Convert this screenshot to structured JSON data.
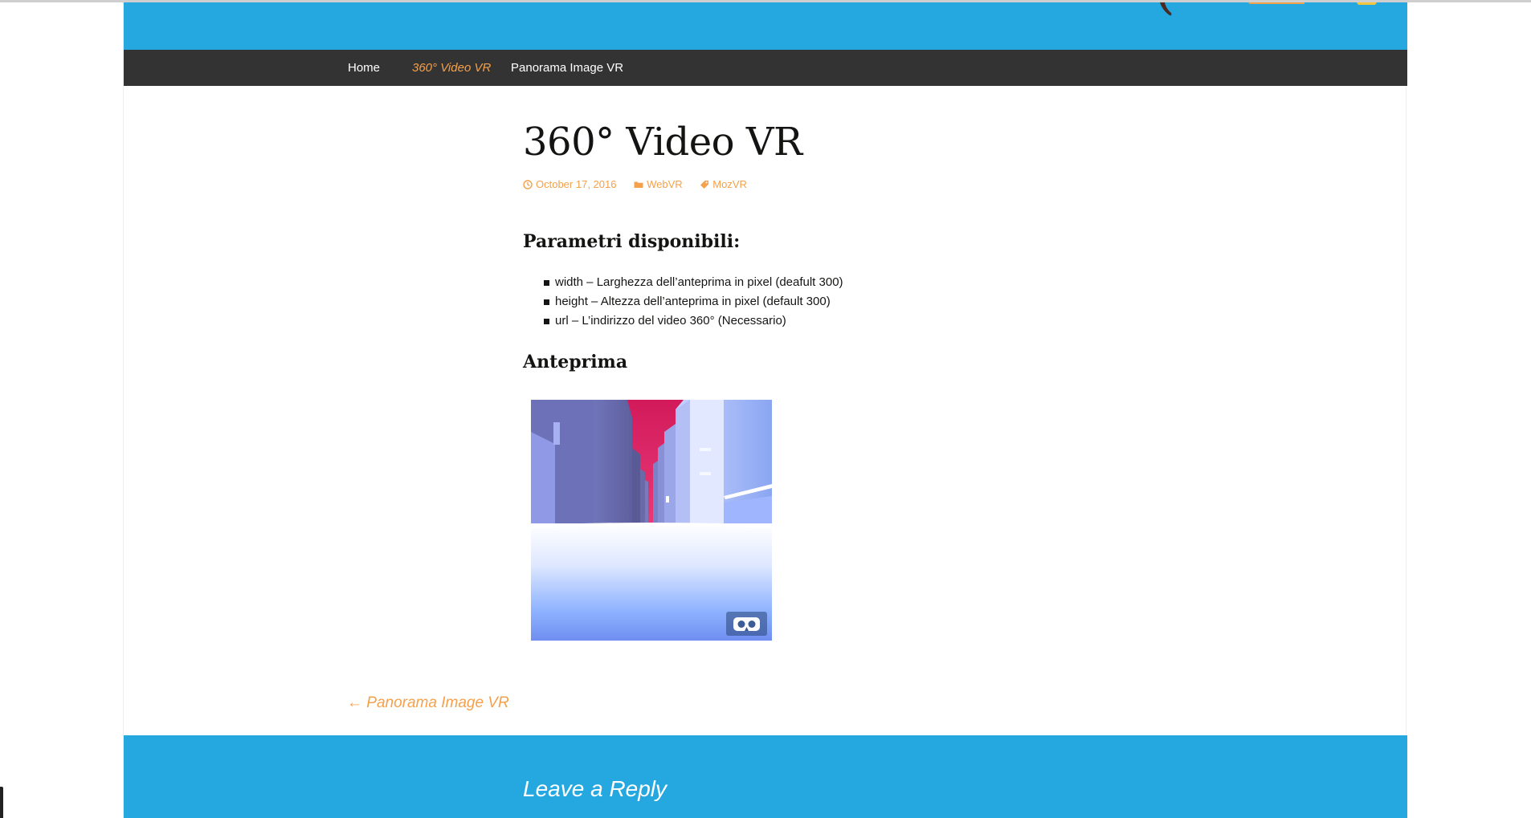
{
  "nav": {
    "items": [
      {
        "label": "Home"
      },
      {
        "label": "360° Video VR"
      },
      {
        "label": "Panorama Image VR"
      }
    ],
    "active_index": 1
  },
  "post": {
    "title": "360° Video VR",
    "meta": {
      "date": "October 17, 2016",
      "category": "WebVR",
      "tag": "MozVR"
    },
    "params_heading": "Parametri disponibili:",
    "params": [
      "width – Larghezza dell’anteprima in pixel (deafult 300)",
      "height – Altezza dell’anteprima in pixel (default 300)",
      "url – L’indirizzo del video 360° (Necessario)"
    ],
    "preview_heading": "Anteprima"
  },
  "post_navigation": {
    "prev_label": "← Panorama Image VR"
  },
  "comments": {
    "reply_title": "Leave a Reply"
  },
  "colors": {
    "header_blue": "#25a8e0",
    "nav_dark": "#333333",
    "accent_orange": "#f5a04a",
    "text_dark": "#141412"
  },
  "icons": {
    "date": "clock-icon",
    "category": "folder-icon",
    "tag": "tag-icon",
    "vr": "cardboard-vr-icon"
  }
}
